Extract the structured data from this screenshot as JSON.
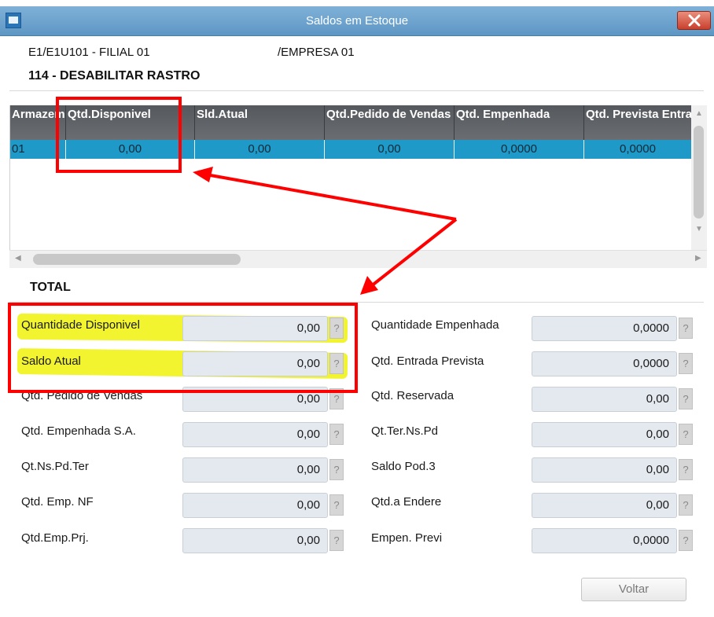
{
  "window": {
    "title": "Saldos em Estoque"
  },
  "header": {
    "branch": "E1/E1U101 - FILIAL 01",
    "company": "/EMPRESA 01",
    "product": "114 - DESABILITAR RASTRO"
  },
  "grid": {
    "columns": [
      "Armazem",
      "Qtd.Disponivel",
      "Sld.Atual",
      "Qtd.Pedido de Vendas",
      "Qtd. Empenhada",
      "Qtd. Prevista Entrada"
    ],
    "rows": [
      [
        "01",
        "0,00",
        "0,00",
        "0,00",
        "0,0000",
        "0,0000"
      ]
    ]
  },
  "totals": {
    "title": "TOTAL",
    "left": [
      {
        "label": "Quantidade Disponivel",
        "value": "0,00"
      },
      {
        "label": "Saldo Atual",
        "value": "0,00"
      },
      {
        "label": "Qtd. Pedido de Vendas",
        "value": "0,00"
      },
      {
        "label": "Qtd. Empenhada S.A.",
        "value": "0,00"
      },
      {
        "label": "Qt.Ns.Pd.Ter",
        "value": "0,00"
      },
      {
        "label": "Qtd. Emp. NF",
        "value": "0,00"
      },
      {
        "label": "Qtd.Emp.Prj.",
        "value": "0,00"
      }
    ],
    "right": [
      {
        "label": "Quantidade Empenhada",
        "value": "0,0000"
      },
      {
        "label": "Qtd. Entrada Prevista",
        "value": "0,0000"
      },
      {
        "label": "Qtd. Reservada",
        "value": "0,00"
      },
      {
        "label": "Qt.Ter.Ns.Pd",
        "value": "0,00"
      },
      {
        "label": "Saldo Pod.3",
        "value": "0,00"
      },
      {
        "label": "Qtd.a Endere",
        "value": "0,00"
      },
      {
        "label": "Empen. Previ",
        "value": "0,0000"
      }
    ],
    "help_glyph": "?"
  },
  "buttons": {
    "back": "Voltar"
  },
  "icons": {
    "app": "window-app-icon",
    "close": "close-icon",
    "help": "help-icon",
    "scroll_up": "chevron-up-icon",
    "scroll_down": "chevron-down-icon",
    "scroll_left": "chevron-left-icon",
    "scroll_right": "chevron-right-icon"
  },
  "colors": {
    "titlebar": "#6fa4cf",
    "grid_header": "#5f6368",
    "selected_row": "#1e99c8",
    "annotation": "#ff0000",
    "highlight": "#eef200"
  }
}
